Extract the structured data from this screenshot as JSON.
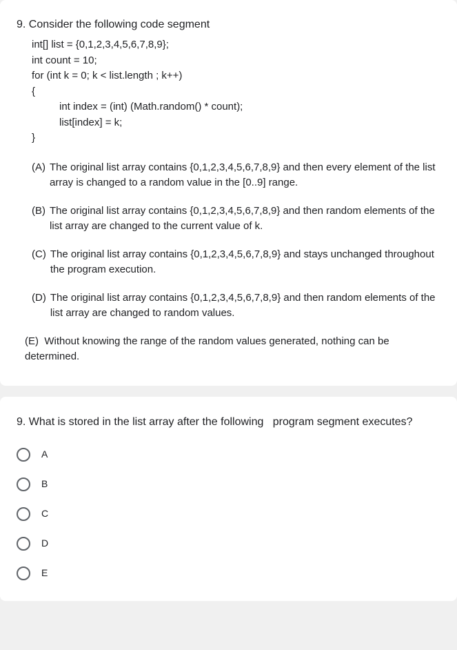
{
  "card1": {
    "title": "9. Consider the following code segment",
    "code": {
      "l1": "int[] list = {0,1,2,3,4,5,6,7,8,9};",
      "l2": "int count = 10;",
      "l3": "for (int k = 0; k < list.length ; k++)",
      "l4": "{",
      "l5": "int index = (int) (Math.random() * count);",
      "l6": "list[index] = k;",
      "l7": "}"
    },
    "options": {
      "a_label": "(A)",
      "a_text": "The original list array contains {0,1,2,3,4,5,6,7,8,9} and then every element of the list array is changed to a random value in the [0..9] range.",
      "b_label": "(B)",
      "b_text": "The original list array contains {0,1,2,3,4,5,6,7,8,9} and then random elements of the list array are changed to the current value of k.",
      "c_label": "(C)",
      "c_text": "The original list array contains {0,1,2,3,4,5,6,7,8,9} and stays unchanged throughout the program execution.",
      "d_label": "(D)",
      "d_text": "The original list array contains {0,1,2,3,4,5,6,7,8,9} and then random elements of the list array are changed to random values.",
      "e_label": "(E)",
      "e_text": "Without knowing the range of the random values generated, nothing can be determined."
    }
  },
  "card2": {
    "title": "9. What is stored in the list array after the following   program segment executes?",
    "choices": {
      "a": "A",
      "b": "B",
      "c": "C",
      "d": "D",
      "e": "E"
    }
  }
}
